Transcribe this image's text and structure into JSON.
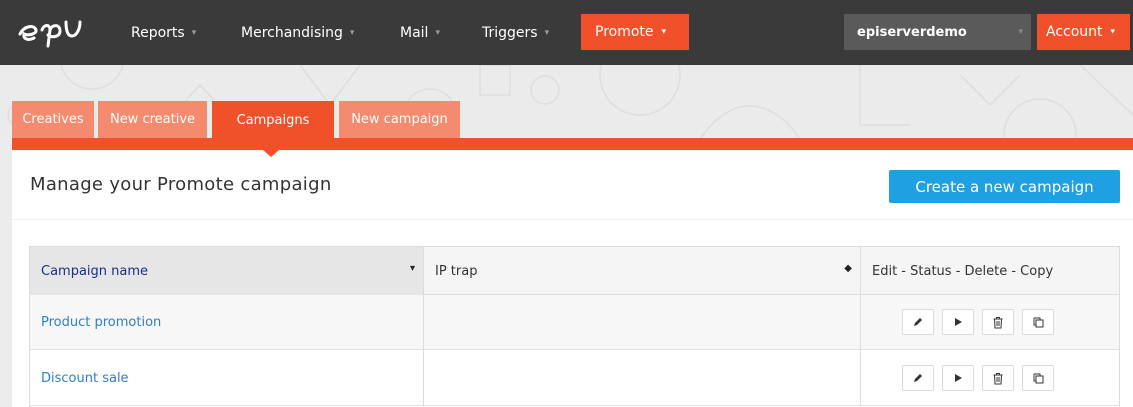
{
  "brand": {
    "logo_text": "epi"
  },
  "nav": {
    "items": [
      {
        "label": "Reports"
      },
      {
        "label": "Merchandising"
      },
      {
        "label": "Mail"
      },
      {
        "label": "Triggers"
      }
    ],
    "promote": {
      "label": "Promote"
    },
    "site_select": {
      "value": "episerverdemo"
    },
    "account": {
      "label": "Account"
    },
    "caret": "▾"
  },
  "tabs": [
    {
      "label": "Creatives",
      "active": false
    },
    {
      "label": "New creative",
      "active": false
    },
    {
      "label": "Campaigns",
      "active": true
    },
    {
      "label": "New campaign",
      "active": false
    }
  ],
  "page": {
    "title": "Manage your Promote campaign",
    "create_button": "Create a new campaign"
  },
  "table": {
    "headers": [
      {
        "label": "Campaign name",
        "sort": "▾"
      },
      {
        "label": "IP trap",
        "sort": "◆"
      },
      {
        "label": "Edit - Status - Delete - Copy"
      }
    ],
    "rows": [
      {
        "name": "Product promotion",
        "ip_trap": ""
      },
      {
        "name": "Discount sale",
        "ip_trap": ""
      }
    ],
    "actions": [
      "edit-icon",
      "play-icon",
      "trash-icon",
      "copy-icon"
    ]
  },
  "colors": {
    "accent": "#f0502a",
    "accent_light": "#f48a6e",
    "nav_bg": "#3a3a3a",
    "button_blue": "#1fa0e3",
    "link": "#2f7fc6"
  }
}
